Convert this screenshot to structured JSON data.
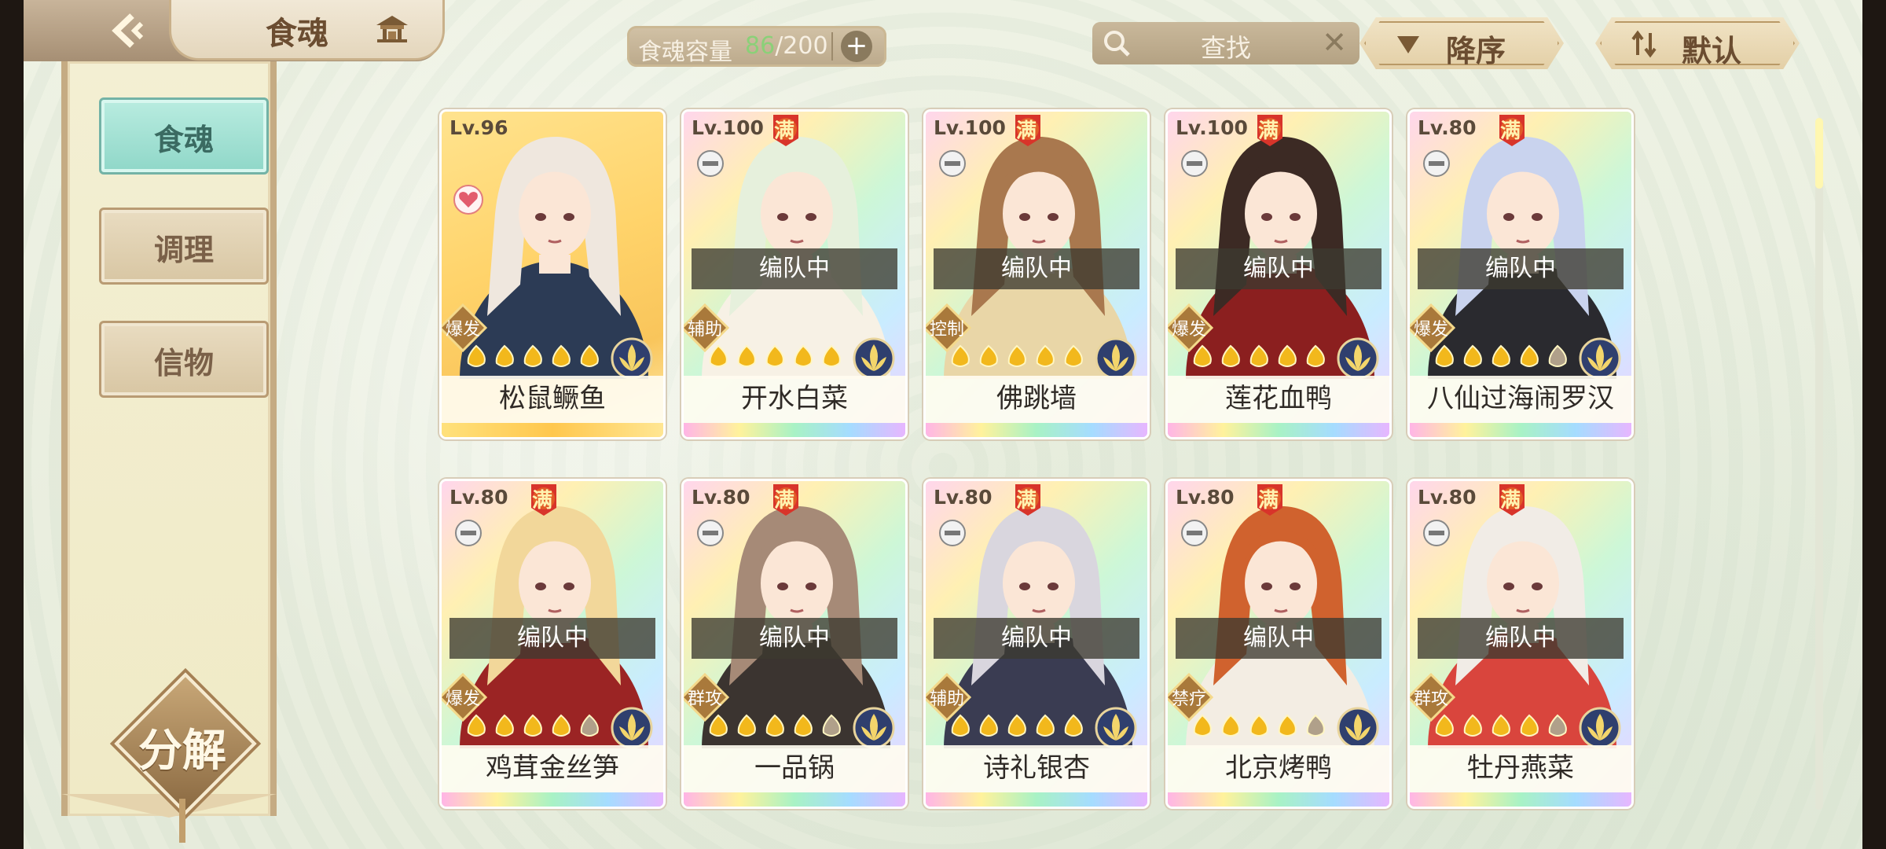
{
  "header": {
    "title": "食魂",
    "capacity_label": "食魂容量",
    "capacity_current": "86",
    "capacity_max": "/200",
    "add_label": "+",
    "search_placeholder": "查找",
    "clear_label": "✕",
    "sort_order_label": "降序",
    "sort_mode_label": "默认"
  },
  "sidebar": {
    "tabs": [
      {
        "label": "食魂",
        "active": true
      },
      {
        "label": "调理",
        "active": false
      },
      {
        "label": "信物",
        "active": false
      }
    ],
    "decompose_label": "分解"
  },
  "cards": [
    {
      "level": "Lv.96",
      "full": false,
      "in_team": false,
      "team_label": "",
      "role": "爆发",
      "stars": 5,
      "name": "松鼠鳜鱼",
      "frame": "gold",
      "heart": true
    },
    {
      "level": "Lv.100",
      "full": true,
      "in_team": true,
      "team_label": "编队中",
      "role": "辅助",
      "stars": 5,
      "name": "开水白菜",
      "frame": "rainbow",
      "heart": false
    },
    {
      "level": "Lv.100",
      "full": true,
      "in_team": true,
      "team_label": "编队中",
      "role": "控制",
      "stars": 5,
      "name": "佛跳墙",
      "frame": "rainbow",
      "heart": false
    },
    {
      "level": "Lv.100",
      "full": true,
      "in_team": true,
      "team_label": "编队中",
      "role": "爆发",
      "stars": 5,
      "name": "莲花血鸭",
      "frame": "rainbow",
      "heart": false
    },
    {
      "level": "Lv.80",
      "full": true,
      "in_team": true,
      "team_label": "编队中",
      "role": "爆发",
      "stars": 4,
      "name": "八仙过海闹罗汉",
      "frame": "rainbow",
      "heart": false
    },
    {
      "level": "Lv.80",
      "full": true,
      "in_team": true,
      "team_label": "编队中",
      "role": "爆发",
      "stars": 4,
      "name": "鸡茸金丝笋",
      "frame": "rainbow",
      "heart": false
    },
    {
      "level": "Lv.80",
      "full": true,
      "in_team": true,
      "team_label": "编队中",
      "role": "群攻",
      "stars": 4,
      "name": "一品锅",
      "frame": "rainbow",
      "heart": false
    },
    {
      "level": "Lv.80",
      "full": true,
      "in_team": true,
      "team_label": "编队中",
      "role": "辅助",
      "stars": 5,
      "name": "诗礼银杏",
      "frame": "rainbow",
      "heart": false
    },
    {
      "level": "Lv.80",
      "full": true,
      "in_team": true,
      "team_label": "编队中",
      "role": "禁疗",
      "stars": 4,
      "name": "北京烤鸭",
      "frame": "rainbow",
      "heart": false
    },
    {
      "level": "Lv.80",
      "full": true,
      "in_team": true,
      "team_label": "编队中",
      "role": "群攻",
      "stars": 4,
      "name": "牡丹燕菜",
      "frame": "rainbow",
      "heart": false
    }
  ],
  "full_badge_label": "满",
  "colors": {
    "accent_teal": "#8fd7c8",
    "gold": "#f2b81c",
    "brown": "#6b4d31"
  }
}
